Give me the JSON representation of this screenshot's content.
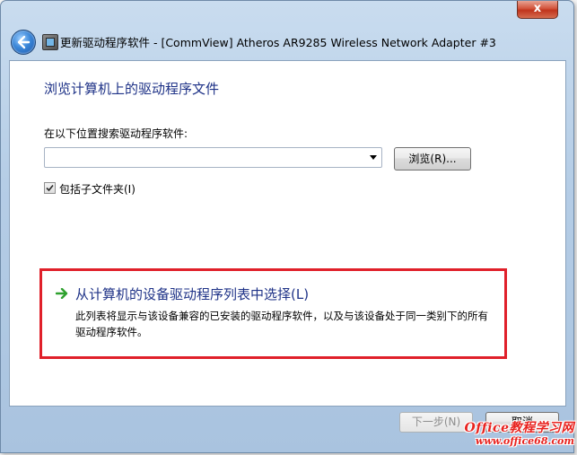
{
  "window": {
    "title": "更新驱动程序软件 - [CommView] Atheros AR9285 Wireless Network Adapter #3",
    "close_label": "x"
  },
  "page": {
    "heading": "浏览计算机上的驱动程序文件",
    "search_label": "在以下位置搜索驱动程序软件:",
    "path_value": "",
    "browse_label": "浏览(R)...",
    "include_subfolders_label": "包括子文件夹(I)",
    "include_subfolders_checked": true
  },
  "option": {
    "title": "从计算机的设备驱动程序列表中选择(L)",
    "description": "此列表将显示与该设备兼容的已安装的驱动程序软件，以及与该设备处于同一类别下的所有驱动程序软件。",
    "highlight_color": "#e0202a"
  },
  "footer": {
    "next_label": "下一步(N)",
    "cancel_label": "取消"
  },
  "watermark": {
    "line1": "Office教程学习网",
    "line2": "www.office68.com"
  },
  "colors": {
    "heading": "#1e3287",
    "frame": "#b5cde6",
    "accent_arrow": "#2fa12f"
  },
  "icons": {
    "back": "back-arrow-icon",
    "app": "device-manager-icon",
    "option_arrow": "green-arrow-icon",
    "combo": "chevron-down-icon"
  }
}
